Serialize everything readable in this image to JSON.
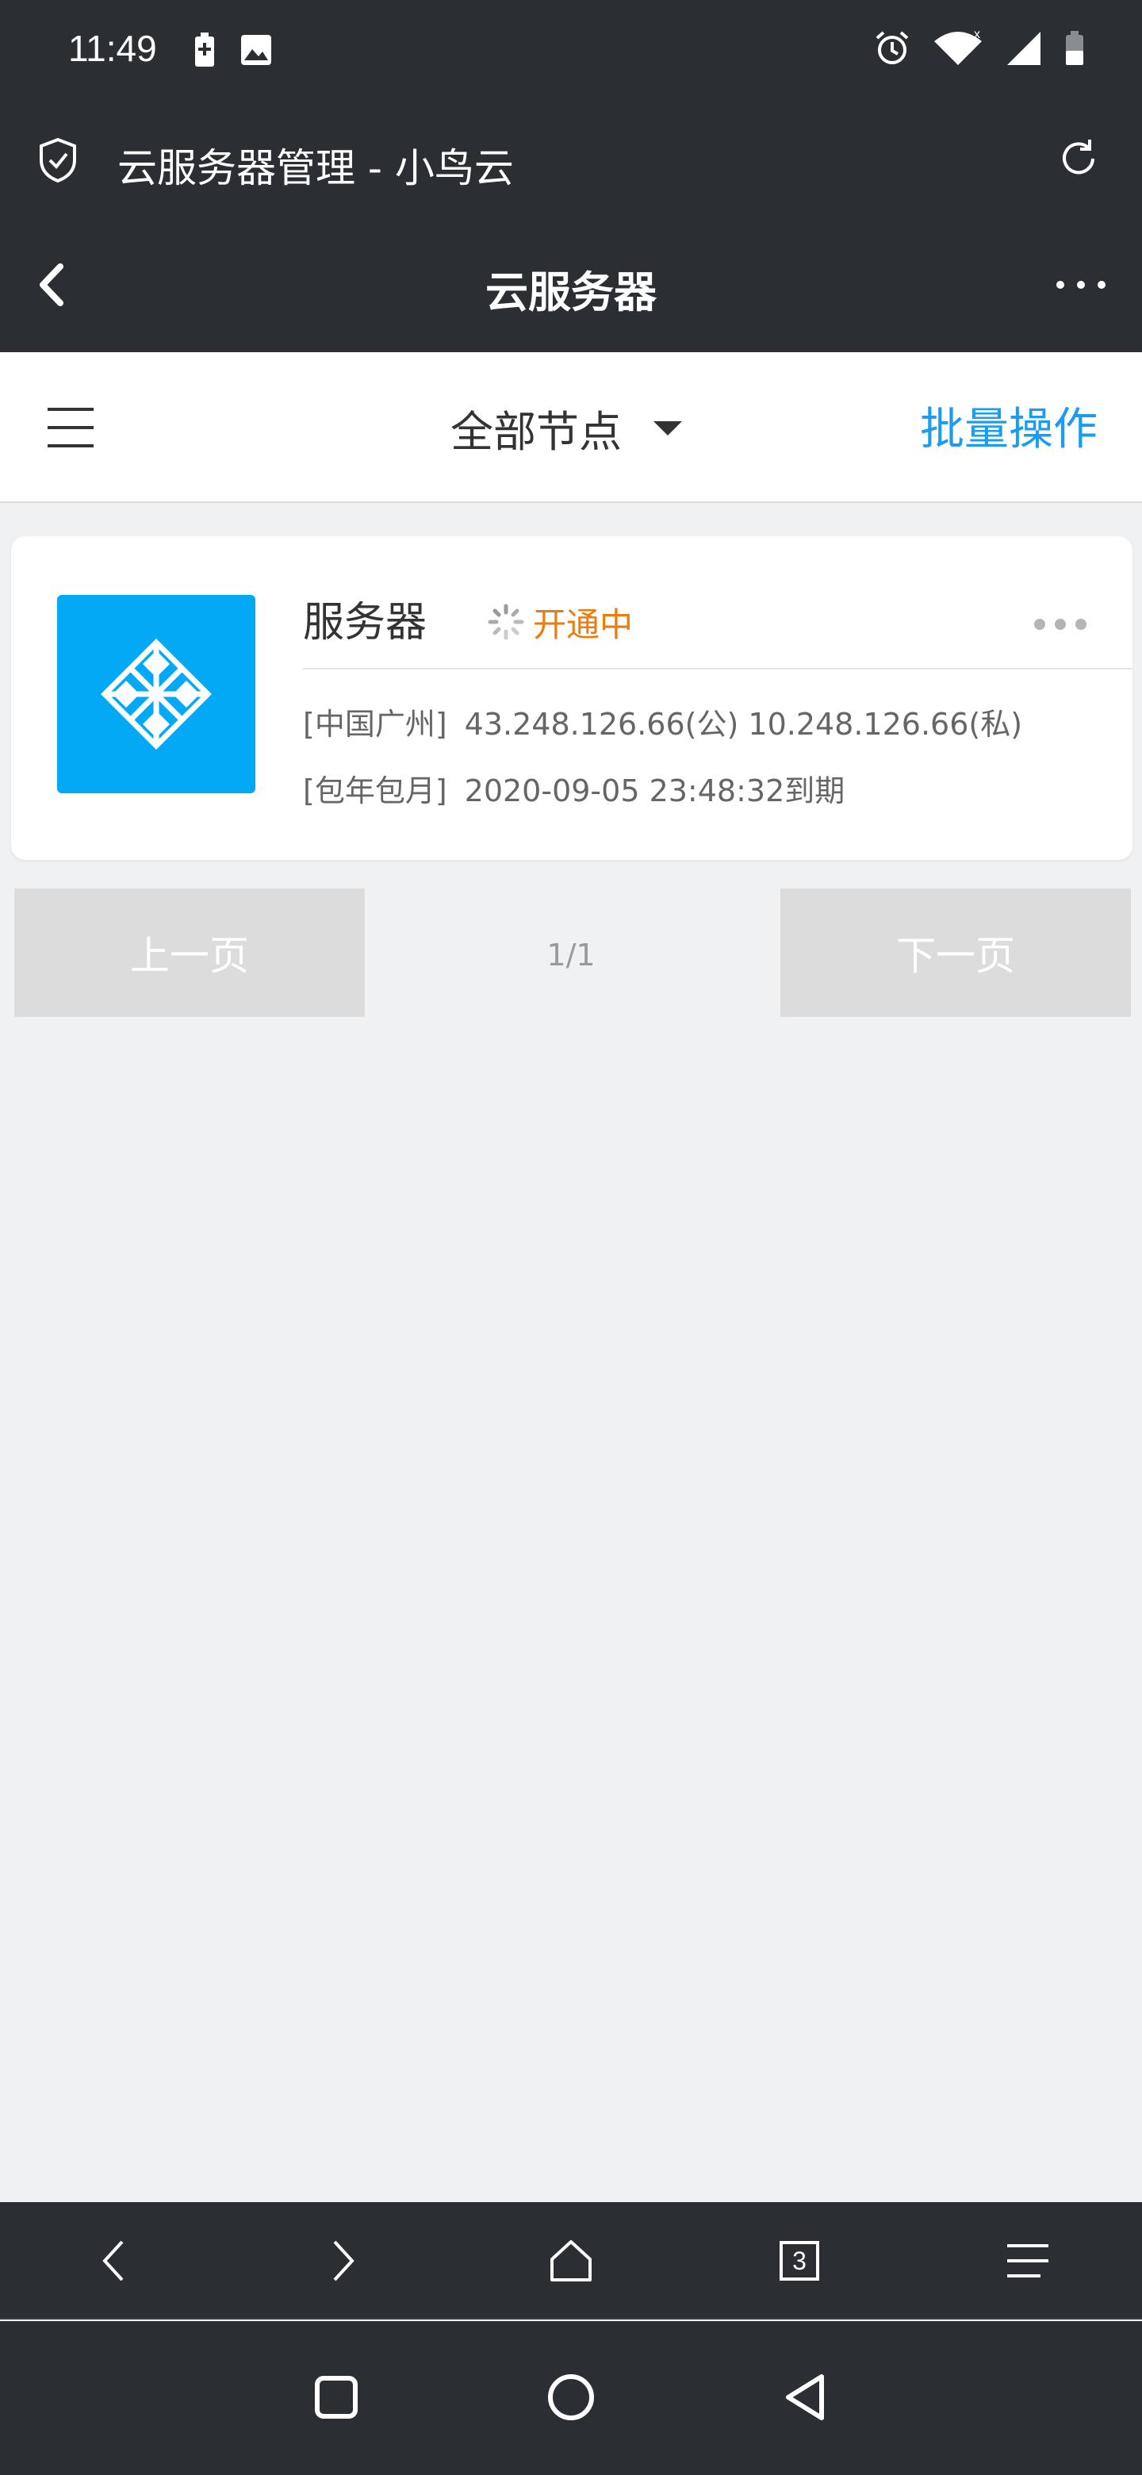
{
  "status_bar": {
    "time": "11:49",
    "left_icons": [
      "battery-charging-icon",
      "image-icon"
    ],
    "right_icons": [
      "alarm-icon",
      "wifi-icon",
      "signal-icon",
      "battery-icon"
    ]
  },
  "browser": {
    "title": "云服务器管理 - 小鸟云",
    "icons": [
      "shield-icon",
      "refresh-icon"
    ]
  },
  "app_header": {
    "title": "云服务器"
  },
  "filter_bar": {
    "node_select": "全部节点",
    "batch_action": "批量操作"
  },
  "servers": [
    {
      "name": "服务器",
      "status": "开通中",
      "location_tag": "[中国广州]",
      "addresses": "43.248.126.66(公) 10.248.126.66(私)",
      "billing_tag": "[包年包月]",
      "expiry": "2020-09-05 23:48:32到期"
    }
  ],
  "pagination": {
    "prev": "上一页",
    "next": "下一页",
    "indicator": "1/1"
  },
  "browser_toolbar": {
    "tab_count": "3"
  },
  "colors": {
    "dark_bar": "#2b2f33",
    "accent_blue": "#1a9df0",
    "status_orange": "#ef7b0c",
    "logo_blue": "#03a9f4",
    "disabled_gray": "#dcdcdc"
  }
}
